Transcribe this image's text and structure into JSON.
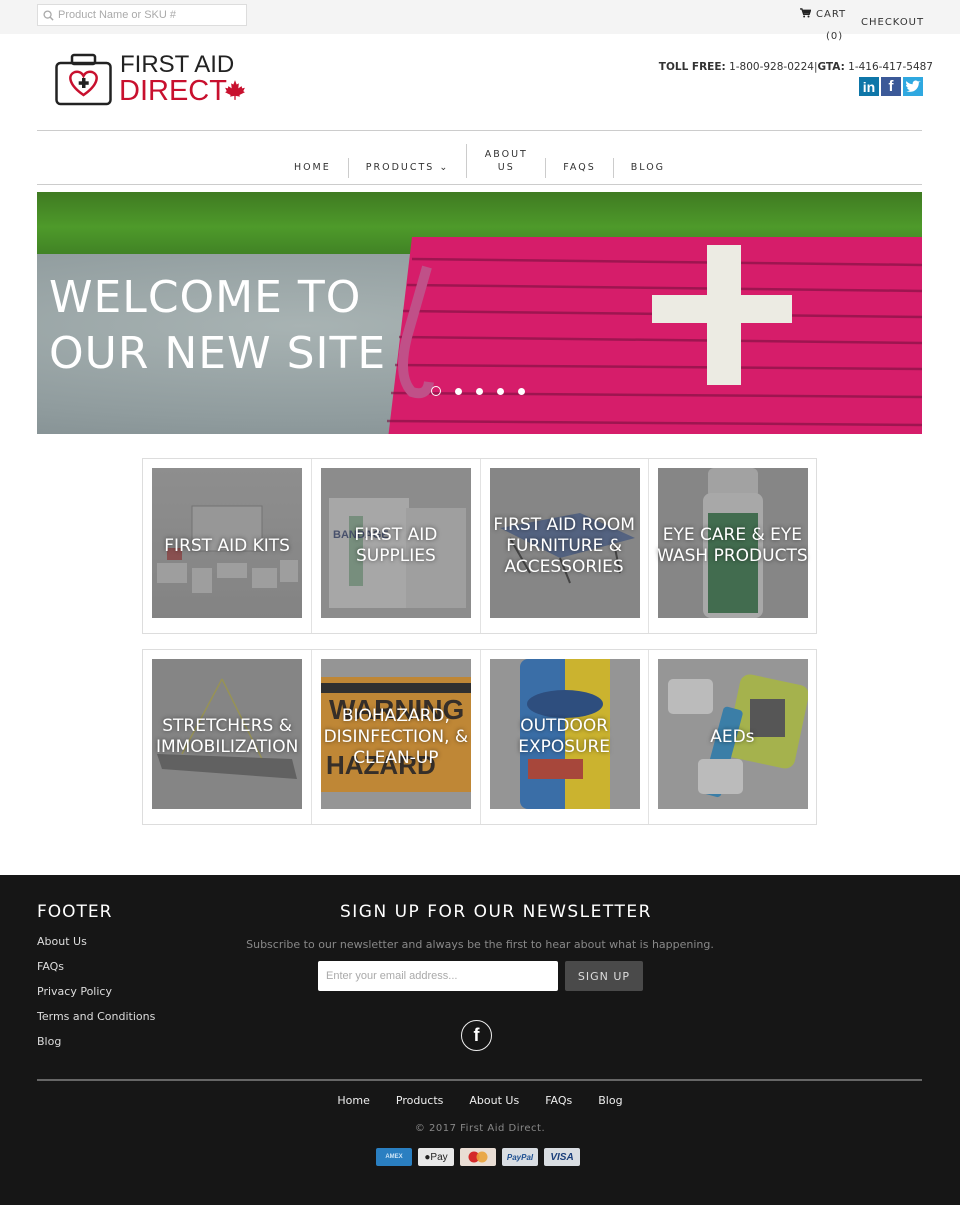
{
  "topbar": {
    "search_placeholder": "Product Name or SKU #",
    "cart_label": "CART",
    "cart_count": "(0)",
    "checkout_label": "CHECKOUT"
  },
  "header": {
    "logo_line1": "FIRST AID",
    "logo_line2": "DIRECT",
    "toll_free_label": "TOLL FREE:",
    "toll_free_number": "1-800-928-0224",
    "separator": "|",
    "gta_label": "GTA:",
    "gta_number": "1-416-417-5487",
    "social": [
      {
        "name": "linkedin",
        "glyph": "in",
        "color": "#0e76a8"
      },
      {
        "name": "facebook",
        "glyph": "f",
        "color": "#3b5998"
      },
      {
        "name": "twitter",
        "glyph": "t",
        "color": "#2fa8e0"
      }
    ]
  },
  "nav": {
    "items": [
      {
        "label": "HOME"
      },
      {
        "label": "PRODUCTS ⌄"
      },
      {
        "label": "ABOUT US"
      },
      {
        "label": "FAQS"
      },
      {
        "label": "BLOG"
      }
    ]
  },
  "hero": {
    "title_line1": "WELCOME TO",
    "title_line2": "OUR NEW SITE",
    "slide_count": 5,
    "active_slide": 1
  },
  "collections": [
    {
      "title": "FIRST AID KITS"
    },
    {
      "title": "FIRST AID SUPPLIES"
    },
    {
      "title": "FIRST AID ROOM FURNITURE & ACCESSORIES"
    },
    {
      "title": "EYE CARE & EYE WASH PRODUCTS"
    },
    {
      "title": "STRETCHERS & IMMOBILIZATION"
    },
    {
      "title": "BIOHAZARD, DISINFECTION, & CLEAN-UP"
    },
    {
      "title": "OUTDOOR EXPOSURE"
    },
    {
      "title": "AEDs"
    }
  ],
  "footer": {
    "heading": "FOOTER",
    "links": [
      "About Us",
      "FAQs",
      "Privacy Policy",
      "Terms and Conditions",
      "Blog"
    ],
    "newsletter": {
      "heading": "SIGN UP FOR OUR NEWSLETTER",
      "subtext": "Subscribe to our newsletter and always be the first to hear about what is happening.",
      "email_placeholder": "Enter your email address...",
      "button_label": "SIGN UP"
    },
    "bottom_nav": [
      "Home",
      "Products",
      "About Us",
      "FAQs",
      "Blog"
    ],
    "copyright": "© 2017 First Aid Direct.",
    "payments": [
      {
        "name": "american-express",
        "label": "AMEX",
        "bg": "#2a7fc1",
        "fg": "#cfe6f7"
      },
      {
        "name": "apple-pay",
        "label": " Pay",
        "bg": "#e8e8e8",
        "fg": "#222"
      },
      {
        "name": "mastercard",
        "label": "",
        "bg": "#e9ddd4",
        "fg": "#c33"
      },
      {
        "name": "paypal",
        "label": "PayPal",
        "bg": "#d9dde2",
        "fg": "#1d4f91"
      },
      {
        "name": "visa",
        "label": "VISA",
        "bg": "#d9dde2",
        "fg": "#1a3e7a"
      }
    ]
  }
}
